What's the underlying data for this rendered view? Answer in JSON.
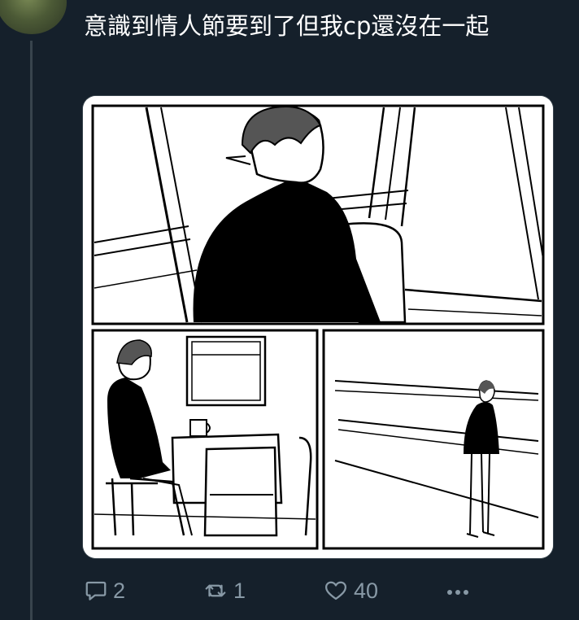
{
  "tweet": {
    "text": "意識到情人節要到了但我cp還沒在一起"
  },
  "actions": {
    "reply_count": "2",
    "retweet_count": "1",
    "like_count": "40"
  },
  "icons": {
    "reply": "reply-icon",
    "retweet": "retweet-icon",
    "like": "heart-icon",
    "more": "more-icon"
  },
  "colors": {
    "background": "#15202b",
    "thread_line": "#38444d",
    "muted": "#8899a6",
    "text": "#ffffff"
  }
}
